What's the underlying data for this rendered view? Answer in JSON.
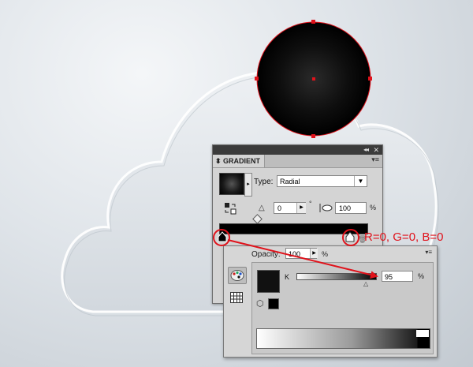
{
  "gradient_panel": {
    "tab_label": "GRADIENT",
    "type_label": "Type:",
    "type_value": "Radial",
    "angle_value": "0",
    "degree_symbol": "°",
    "aspect_value": "100",
    "aspect_unit": "%"
  },
  "color_panel": {
    "opacity_label": "Opacity:",
    "opacity_value": "100",
    "opacity_unit": "%",
    "channel_label": "K",
    "k_value": "95",
    "k_unit": "%"
  },
  "annotation": {
    "text": "R=0, G=0, B=0",
    "color": "#e0121b"
  },
  "colors": {
    "accent_red": "#e0121b",
    "circle_fill": "#000000",
    "panel_bg": "#d4d4d4"
  }
}
